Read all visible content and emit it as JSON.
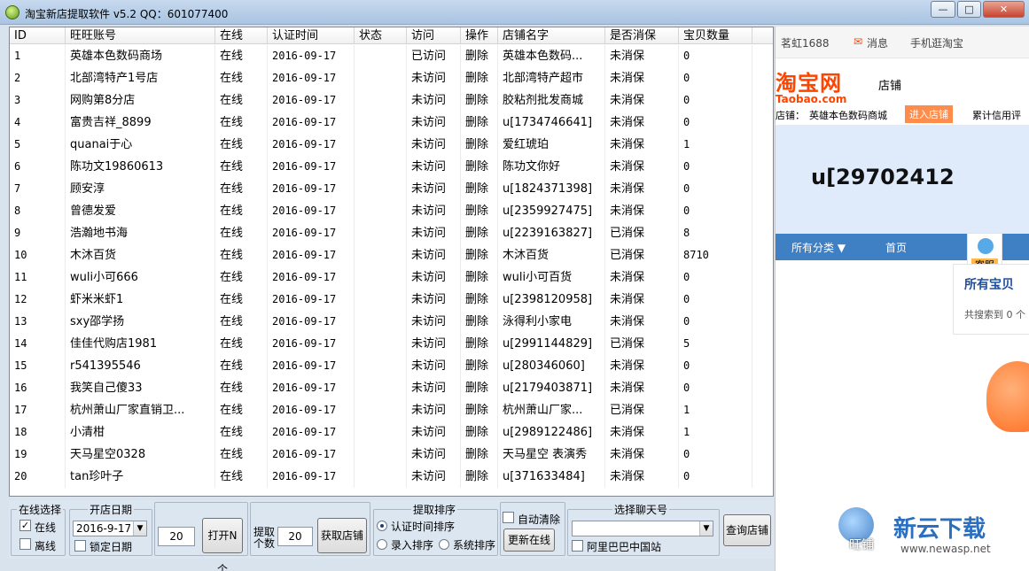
{
  "window": {
    "title": "淘宝新店提取软件 v5.2  QQ：601077400",
    "controls": [
      "—",
      "□",
      "✕"
    ]
  },
  "table": {
    "columns": [
      "ID",
      "旺旺账号",
      "在线",
      "认证时间",
      "状态",
      "访问",
      "操作",
      "店铺名字",
      "是否消保",
      "宝贝数量"
    ],
    "rows": [
      [
        "1",
        "英雄本色数码商场",
        "在线",
        "2016-09-17",
        "",
        "已访问",
        "删除",
        "英雄本色数码...",
        "未消保",
        "0"
      ],
      [
        "2",
        "北部湾特产1号店",
        "在线",
        "2016-09-17",
        "",
        "未访问",
        "删除",
        "北部湾特产超市",
        "未消保",
        "0"
      ],
      [
        "3",
        "网购第8分店",
        "在线",
        "2016-09-17",
        "",
        "未访问",
        "删除",
        "胶粘剂批发商城",
        "未消保",
        "0"
      ],
      [
        "4",
        "富贵吉祥_8899",
        "在线",
        "2016-09-17",
        "",
        "未访问",
        "删除",
        "u[1734746641]",
        "未消保",
        "0"
      ],
      [
        "5",
        "quanai于心",
        "在线",
        "2016-09-17",
        "",
        "未访问",
        "删除",
        "爱红琥珀",
        "未消保",
        "1"
      ],
      [
        "6",
        "陈功文19860613",
        "在线",
        "2016-09-17",
        "",
        "未访问",
        "删除",
        "陈功文你好",
        "未消保",
        "0"
      ],
      [
        "7",
        "顾安淳",
        "在线",
        "2016-09-17",
        "",
        "未访问",
        "删除",
        "u[1824371398]",
        "未消保",
        "0"
      ],
      [
        "8",
        "曾德发爱",
        "在线",
        "2016-09-17",
        "",
        "未访问",
        "删除",
        "u[2359927475]",
        "未消保",
        "0"
      ],
      [
        "9",
        "浩瀚地书海",
        "在线",
        "2016-09-17",
        "",
        "未访问",
        "删除",
        "u[2239163827]",
        "已消保",
        "8"
      ],
      [
        "10",
        "木沐百货",
        "在线",
        "2016-09-17",
        "",
        "未访问",
        "删除",
        "木沐百货",
        "已消保",
        "8710"
      ],
      [
        "11",
        "wuli小可666",
        "在线",
        "2016-09-17",
        "",
        "未访问",
        "删除",
        "wuli小可百货",
        "未消保",
        "0"
      ],
      [
        "12",
        "虾米米虾1",
        "在线",
        "2016-09-17",
        "",
        "未访问",
        "删除",
        "u[2398120958]",
        "未消保",
        "0"
      ],
      [
        "13",
        "sxy邵学扬",
        "在线",
        "2016-09-17",
        "",
        "未访问",
        "删除",
        "泳得利小家电",
        "未消保",
        "0"
      ],
      [
        "14",
        "佳佳代购店1981",
        "在线",
        "2016-09-17",
        "",
        "未访问",
        "删除",
        "u[2991144829]",
        "已消保",
        "5"
      ],
      [
        "15",
        "r541395546",
        "在线",
        "2016-09-17",
        "",
        "未访问",
        "删除",
        "u[280346060]",
        "未消保",
        "0"
      ],
      [
        "16",
        "我笑自己傻33",
        "在线",
        "2016-09-17",
        "",
        "未访问",
        "删除",
        "u[2179403871]",
        "未消保",
        "0"
      ],
      [
        "17",
        "杭州萧山厂家直销卫...",
        "在线",
        "2016-09-17",
        "",
        "未访问",
        "删除",
        "杭州萧山厂家...",
        "已消保",
        "1"
      ],
      [
        "18",
        "小清柑",
        "在线",
        "2016-09-17",
        "",
        "未访问",
        "删除",
        "u[2989122486]",
        "未消保",
        "1"
      ],
      [
        "19",
        "天马星空0328",
        "在线",
        "2016-09-17",
        "",
        "未访问",
        "删除",
        "天马星空 表演秀",
        "未消保",
        "0"
      ],
      [
        "20",
        "tan珍叶子",
        "在线",
        "2016-09-17",
        "",
        "未访问",
        "删除",
        "u[371633484]",
        "未消保",
        "0"
      ]
    ]
  },
  "controls": {
    "online_group": {
      "legend": "在线选择",
      "online": "在线",
      "offline": "离线",
      "online_checked": true,
      "offline_checked": false
    },
    "date_group": {
      "legend": "开店日期",
      "date": "2016-9-17",
      "lock_label": "锁定日期",
      "lock_checked": false
    },
    "count_input": "20",
    "open_button": "打开N个",
    "fetch_label_1": "提取",
    "fetch_label_2": "个数",
    "fetch_count": "20",
    "fetch_button": "获取店铺",
    "sort_group": {
      "legend": "提取排序",
      "opt1": "认证时间排序",
      "opt2": "录入排序",
      "opt3": "系统排序",
      "selected": "认证时间排序"
    },
    "auto_clear_label": "自动清除",
    "refresh_button": "更新在线",
    "chat_group": {
      "legend": "选择聊天号",
      "selected": "",
      "alibaba_label": "阿里巴巴中国站",
      "alibaba_checked": false
    },
    "query_button": "查询店铺"
  },
  "browser": {
    "topnav": {
      "user": "茗虹1688",
      "messages": "消息",
      "mobile": "手机逛淘宝"
    },
    "logo_cn": "淘宝网",
    "logo_en": "Taobao.com",
    "store_word": "店铺",
    "store_label": "店铺：",
    "store_name": "英雄本色数码商城",
    "enter_store": "进入店铺",
    "credit": "累计信用评",
    "banner_text": "u[29702412",
    "menu_all": "所有分类 ▼",
    "menu_home": "首页",
    "kefu": "客服",
    "all_items": "所有宝贝",
    "search_found": "共搜索到 0 个"
  },
  "watermark": {
    "brand": "新云下载",
    "url": "www.newasp.net",
    "extra": "旺铺"
  }
}
